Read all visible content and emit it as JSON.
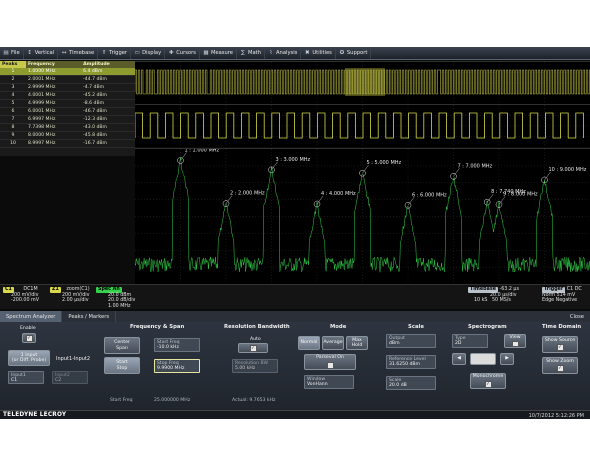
{
  "menu": [
    {
      "label": "File",
      "icon": "folder-icon"
    },
    {
      "label": "Vertical",
      "icon": "vertical-icon"
    },
    {
      "label": "Timebase",
      "icon": "timebase-icon"
    },
    {
      "label": "Trigger",
      "icon": "trigger-icon"
    },
    {
      "label": "Display",
      "icon": "display-icon"
    },
    {
      "label": "Cursors",
      "icon": "cursors-icon"
    },
    {
      "label": "Measure",
      "icon": "measure-icon"
    },
    {
      "label": "Math",
      "icon": "math-icon"
    },
    {
      "label": "Analysis",
      "icon": "analysis-icon"
    },
    {
      "label": "Utilities",
      "icon": "utilities-icon"
    },
    {
      "label": "Support",
      "icon": "support-icon"
    }
  ],
  "peaks_table": {
    "headers": [
      "Peaks",
      "Frequency",
      "Amplitude"
    ],
    "rows": [
      [
        "1",
        "1.0000 MHz",
        "6.4 dBm"
      ],
      [
        "2",
        "2.0001 MHz",
        "-44.7 dBm"
      ],
      [
        "3",
        "2.9999 MHz",
        "-4.7 dBm"
      ],
      [
        "4",
        "4.0001 MHz",
        "-45.2 dBm"
      ],
      [
        "5",
        "4.9999 MHz",
        "-8.6 dBm"
      ],
      [
        "6",
        "6.0001 MHz",
        "-46.7 dBm"
      ],
      [
        "7",
        "6.9997 MHz",
        "-12.3 dBm"
      ],
      [
        "8",
        "7.7398 MHz",
        "-43.0 dBm"
      ],
      [
        "9",
        "8.0000 MHz",
        "-45.8 dBm"
      ],
      [
        "10",
        "8.9997 MHz",
        "-16.7 dBm"
      ]
    ]
  },
  "spectrum_markers": [
    {
      "label": "1 : 1.000 MHz",
      "freq": 1.0,
      "amp": 6.4
    },
    {
      "label": "2 : 2.000 MHz",
      "freq": 2.0,
      "amp": -44.7
    },
    {
      "label": "3 : 3.000 MHz",
      "freq": 3.0,
      "amp": -4.7
    },
    {
      "label": "4 : 4.000 MHz",
      "freq": 4.0,
      "amp": -45.2
    },
    {
      "label": "5 : 5.000 MHz",
      "freq": 5.0,
      "amp": -8.6
    },
    {
      "label": "6 : 6.000 MHz",
      "freq": 6.0,
      "amp": -46.7
    },
    {
      "label": "7 : 7.000 MHz",
      "freq": 7.0,
      "amp": -12.3
    },
    {
      "label": "8 : 7.740 MHz",
      "freq": 7.74,
      "amp": -43.0
    },
    {
      "label": "9 : 8.000 MHz",
      "freq": 8.0,
      "amp": -45.8
    },
    {
      "label": "10 : 9.000 MHz",
      "freq": 9.0,
      "amp": -16.7
    }
  ],
  "channel_info": {
    "c1_badge": "C1",
    "c1_text1": "DC1M",
    "c1_text2": "200 mV/div",
    "c1_text3": "-200.00 mV",
    "z1_badge": "Z1",
    "z1_text1": "zoom(C1)",
    "z1_text2": "200 mV/div",
    "z1_text3": "2.00 µs/div",
    "spec_badge": "Spec An",
    "spec_text1": "20.0 dBm",
    "spec_text2": "20.0 dB/div",
    "spec_text3": "1.00 MHz",
    "timebase_label": "Timebase",
    "timebase_value": "-63.2 µs",
    "timebase_div": "20.0 µs/div",
    "timebase_samples": "10 kS",
    "timebase_rate": "50 MS/s",
    "trigger_label": "Trigger",
    "trigger_ch": "C1 DC",
    "trigger_mode": "Norm",
    "trigger_level": "514 mV",
    "trigger_type": "Edge",
    "trigger_slope": "Negative"
  },
  "tabs": [
    "Spectrum Analyzer",
    "Peaks / Markers"
  ],
  "close_label": "Close",
  "dialog": {
    "enable_label": "Enable",
    "input_btn_line1": "1 input",
    "input_btn_line2": "(or Diff. Probe)",
    "input_mode": "Input1-Input2",
    "input1_label": "Input1",
    "input1_value": "C1",
    "input2_label": "Input2",
    "input2_value": "C2",
    "freq_title": "Frequency & Span",
    "center_span_line1": "Center",
    "center_span_line2": "Span",
    "start_stop_line1": "Start",
    "start_stop_line2": "Stop",
    "start_freq_label": "Start Freq",
    "start_freq_value": "-10.0 kHz",
    "stop_freq_label": "Stop Freq",
    "stop_freq_value": "9.9900 MHz",
    "start_freq_readout_label": "Start Freq",
    "start_freq_readout": "25.000000 MHz",
    "rbw_title": "Resolution Bandwidth",
    "auto_label": "Auto",
    "rbw_label": "Resolution BW",
    "rbw_value": "5.00 kHz",
    "actual_label": "Actual: 9.7653 kHz",
    "mode_title": "Mode",
    "mode_normal": "Normal",
    "mode_average": "Average",
    "mode_max1": "Max",
    "mode_max2": "Hold",
    "parseval_label": "Parseval On",
    "window_label": "Window",
    "window_value": "VonHann",
    "scale_title": "Scale",
    "output_label": "Output",
    "output_value": "dBm",
    "ref_label": "Reference Level",
    "ref_value": "31.6250 dBm",
    "scale_label": "Scale",
    "scale_value": "20.0 dB",
    "spectrogram_title": "Spectrogram",
    "type_label": "Type",
    "type_value": "2D",
    "view_label": "View",
    "left_arrow": "◀",
    "right_arrow": "▶",
    "mono_label": "Monochrome",
    "time_title": "Time Domain",
    "show_source_label": "Show Source",
    "show_zoom_label": "Show Zoom",
    "check": "✓"
  },
  "status": {
    "logo": "TELEDYNE LECROY",
    "datetime": "10/7/2012 5:12:26 PM"
  },
  "colors": {
    "trace_yellow": "#d8d84a",
    "spectrum_green": "#33d24a",
    "marker_white": "#e8e8e8"
  }
}
